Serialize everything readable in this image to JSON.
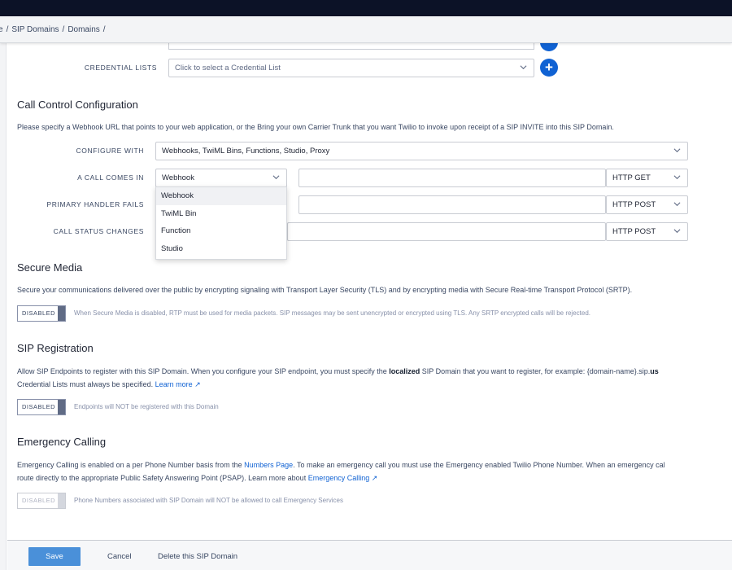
{
  "breadcrumb": [
    "e",
    "/",
    "SIP Domains",
    "/",
    "Domains",
    "/"
  ],
  "credential_lists": {
    "label": "CREDENTIAL LISTS",
    "placeholder": "Click to select a Credential List",
    "add_icon": "plus-icon"
  },
  "call_control": {
    "title": "Call Control Configuration",
    "description": "Please specify a Webhook URL that points to your web application, or the Bring your own Carrier Trunk that you want Twilio to invoke upon receipt of a SIP INVITE into this SIP Domain.",
    "configure_with": {
      "label": "CONFIGURE WITH",
      "value": "Webhooks, TwiML Bins, Functions, Studio, Proxy"
    },
    "call_comes_in": {
      "label": "A CALL COMES IN",
      "value": "Webhook",
      "url": "",
      "method": "HTTP GET"
    },
    "primary_handler_fails": {
      "label": "PRIMARY HANDLER FAILS",
      "url": "",
      "method": "HTTP POST"
    },
    "call_status_changes": {
      "label": "CALL STATUS CHANGES",
      "url": "",
      "method": "HTTP POST"
    },
    "dropdown_options": [
      "Webhook",
      "TwiML Bin",
      "Function",
      "Studio"
    ]
  },
  "secure_media": {
    "title": "Secure Media",
    "description": "Secure your communications delivered over the public by encrypting signaling with Transport Layer Security (TLS) and by encrypting media with Secure Real-time Transport Protocol (SRTP).",
    "toggle": "DISABLED",
    "hint": "When Secure Media is disabled, RTP must be used for media packets. SIP messages may be sent unencrypted or encrypted using TLS. Any SRTP encrypted calls will be rejected."
  },
  "sip_registration": {
    "title": "SIP Registration",
    "line1_a": "Allow SIP Endpoints to register with this SIP Domain. When you configure your SIP endpoint, you must specify the ",
    "line1_bold": "localized",
    "line1_b": " SIP Domain that you want to register, for example: {domain-name}.sip.",
    "line1_c": "us",
    "line2_a": "Credential Lists must always be specified. ",
    "learn_more": "Learn more ↗",
    "toggle": "DISABLED",
    "hint": "Endpoints will NOT be registered with this Domain"
  },
  "emergency_calling": {
    "title": "Emergency Calling",
    "line1_a": "Emergency Calling is enabled on a per Phone Number basis from the ",
    "numbers_page": "Numbers Page",
    "line1_b": ". To make an emergency call you must use the Emergency enabled Twilio Phone Number. When an emergency cal",
    "line2_a": "route directly to the appropriate Public Safety Answering Point (PSAP). Learn more about ",
    "emergency_link": "Emergency Calling ↗",
    "toggle": "DISABLED",
    "hint": "Phone Numbers associated with SIP Domain will NOT be allowed to call Emergency Services"
  },
  "footer": {
    "save": "Save",
    "cancel": "Cancel",
    "delete": "Delete this SIP Domain"
  },
  "colors": {
    "accent": "#1062d3",
    "save_button": "#4a90d9",
    "topbar": "#0c1227"
  }
}
